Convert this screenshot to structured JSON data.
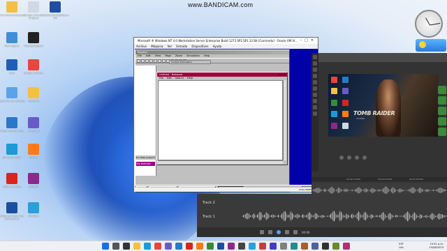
{
  "watermark": "www.BANDICAM.com",
  "desktop_icons": [
    {
      "label": "Ibro Novitecnologias",
      "color": "#f2c144"
    },
    {
      "label": "Google Chrome Original",
      "color": "#cfd8e4"
    },
    {
      "label": "Telebiliable Biblioteca HD",
      "color": "#1e4fa0"
    },
    {
      "label": "Plan Egipcio",
      "color": "#3e8ed8"
    },
    {
      "label": "YUcoteoEgipcio",
      "color": "#222222"
    },
    {
      "label": "Red",
      "color": "#1f5fb8"
    },
    {
      "label": "Google Chrome",
      "color": "#e8453c"
    },
    {
      "label": "Papelera de reciclaje",
      "color": "#5aa3e8"
    },
    {
      "label": "Carpetas",
      "color": "#f2c144"
    },
    {
      "label": "Visual Studio Code",
      "color": "#2a78c8"
    },
    {
      "label": "VideoPad",
      "color": "#6a5ac8"
    },
    {
      "label": "Microsoft Edge",
      "color": "#1b9ad6"
    },
    {
      "label": "Firefox",
      "color": "#ff7a1a"
    },
    {
      "label": "Adobe Acrobat",
      "color": "#d9241c"
    },
    {
      "label": "WinRAR",
      "color": "#8a2a8a"
    },
    {
      "label": "Sistema Arcano de Facturacion",
      "color": "#1a4fa0"
    },
    {
      "label": "MiniTool",
      "color": "#2aa0d8"
    }
  ],
  "vm": {
    "title": "Microsoft ® Windows NT 4.0 Workstation Server Enterprise Build 1273 SP2 SP1 32 Bit [Corriendo] - Oracle VM Vi...",
    "menu": [
      "Archivo",
      "Máquina",
      "Ver",
      "Entrada",
      "Dispositivos",
      "Ayuda"
    ],
    "status": "CTRL DERECHA"
  },
  "nt": {
    "window_title": "Registry",
    "menu": [
      "File",
      "Edit",
      "View",
      "Page",
      "Zoom",
      "Simulation",
      "Help"
    ],
    "info_box": "Contact Information",
    "help_text": "For Help, press F1",
    "selected_item": "My Brief.exe",
    "notepad": {
      "title": "Untitled - Notepad",
      "menu": [
        "File",
        "Edit",
        "Search",
        "Help"
      ]
    },
    "taskbar": {
      "start": "Start",
      "items": [
        "Calculator",
        "Imaging",
        "Untitled - Notepad"
      ],
      "clock": "12:09 PM"
    }
  },
  "editor": {
    "preview_logo": "TOMB RAIDER",
    "preview_sub": "LEGEND",
    "timecodes": [
      "00:02:10.000",
      "00:02:20.000",
      "00:02:30.000"
    ],
    "tracks": [
      "Track 2",
      "Track 1"
    ],
    "player_time": "00:00"
  },
  "taskbar": {
    "lang_top": "ESP",
    "lang_bottom": "LAA",
    "time": "10:51 p.m.",
    "date": "10/08/2023"
  }
}
